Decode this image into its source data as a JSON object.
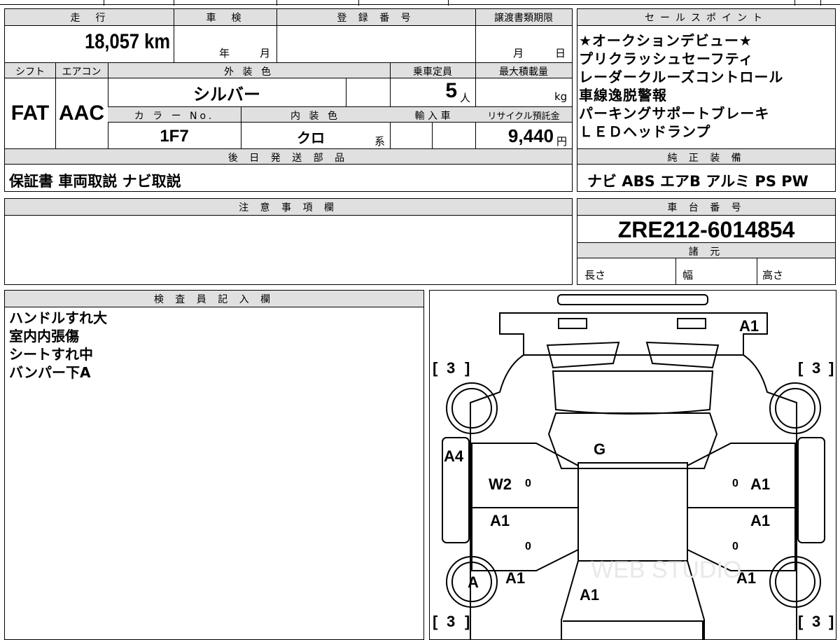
{
  "vehicle": {
    "mileage_label": "走　行",
    "mileage": "18,057 km",
    "shaken_label": "車　検",
    "shaken_year_unit": "年",
    "shaken_month_unit": "月",
    "reg_label": "登 録 番 号",
    "transfer_label": "譲渡書類期限",
    "transfer_month_unit": "月",
    "transfer_day_unit": "日",
    "shift_label": "シフト",
    "shift": "FAT",
    "ac_label": "エアコン",
    "ac": "AAC",
    "ext_color_label": "外 装 色",
    "ext_color": "シルバー",
    "seats_label": "乗車定員",
    "seats": "5",
    "seats_unit": "人",
    "maxload_label": "最大積載量",
    "maxload_unit": "kg",
    "color_no_label": "カ ラ ー No.",
    "color_no": "1F7",
    "int_color_label": "内 装 色",
    "int_color": "クロ",
    "int_color_suffix": "系",
    "import_label": "輸 入 車",
    "recycle_label": "リサイクル預託金",
    "recycle": "9,440",
    "recycle_unit": "円",
    "later_parts_label": "後 日 発 送 部 品",
    "later_parts": "保証書 車両取説 ナビ取説"
  },
  "sales_points": {
    "label": "セールスポイント",
    "lines": [
      "★オークションデビュー★",
      "プリクラッシュセーフティ",
      "レーダークルーズコントロール",
      "車線逸脱警報",
      "パーキングサポートブレーキ",
      "ＬＥＤヘッドランプ"
    ]
  },
  "equipment": {
    "label": "純 正 装 備",
    "value": "ナビ ABS エアB アルミ PS PW"
  },
  "notes": {
    "label": "注 意 事 項 欄",
    "value": ""
  },
  "chassis": {
    "label": "車 台 番 号",
    "value": "ZRE212-6014854",
    "spec_label": "諸 元",
    "length_label": "長さ",
    "width_label": "幅",
    "height_label": "高さ"
  },
  "inspector": {
    "label": "検 査 員 記 入 欄",
    "lines": [
      "ハンドルすれ大",
      "室内内張傷",
      "シートすれ中",
      "バンパー下A"
    ]
  },
  "diagram": {
    "marks": {
      "front_bumper": "A1",
      "hood": "G",
      "front_left_fender": "A4",
      "front_left_door": "W2",
      "front_right_door": "A1",
      "rear_left_door": "A1",
      "rear_right_door": "A1",
      "rear_left_wheel": "A",
      "rear_left_quarter": "A1",
      "rear_right_quarter": "A1",
      "trunk": "A1"
    },
    "tire_values": [
      "3",
      "3",
      "3",
      "3"
    ],
    "door_zero": "0",
    "watermark": "WEB STUDIO"
  }
}
